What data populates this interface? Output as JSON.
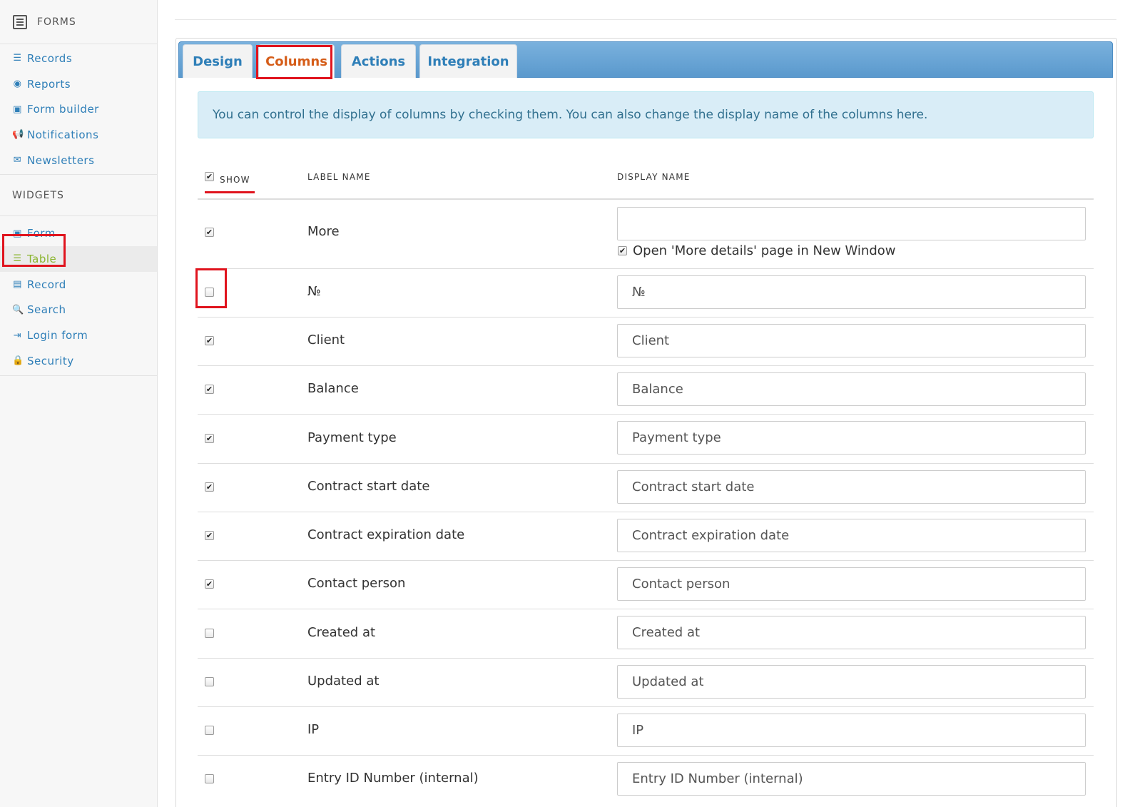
{
  "sidebar": {
    "title": "FORMS",
    "items": [
      {
        "label": "Records",
        "icon": "list-icon",
        "glyph": "☰"
      },
      {
        "label": "Reports",
        "icon": "target-icon",
        "glyph": "◉"
      },
      {
        "label": "Form builder",
        "icon": "form-icon",
        "glyph": "▣"
      },
      {
        "label": "Notifications",
        "icon": "megaphone-icon",
        "glyph": "📢"
      },
      {
        "label": "Newsletters",
        "icon": "envelope-icon",
        "glyph": "✉"
      }
    ],
    "widgets_title": "WIDGETS",
    "widgets": [
      {
        "label": "Form",
        "icon": "form-icon",
        "glyph": "▣",
        "active": false
      },
      {
        "label": "Table",
        "icon": "table-icon",
        "glyph": "☰",
        "active": true
      },
      {
        "label": "Record",
        "icon": "record-icon",
        "glyph": "▤",
        "active": false
      },
      {
        "label": "Search",
        "icon": "search-icon",
        "glyph": "🔍",
        "active": false
      },
      {
        "label": "Login form",
        "icon": "login-icon",
        "glyph": "⇥",
        "active": false
      },
      {
        "label": "Security",
        "icon": "lock-icon",
        "glyph": "🔒",
        "active": false
      }
    ]
  },
  "tabs": [
    {
      "label": "Design",
      "active": false
    },
    {
      "label": "Columns",
      "active": true
    },
    {
      "label": "Actions",
      "active": false
    },
    {
      "label": "Integration",
      "active": false
    }
  ],
  "info_text": "You can control the display of columns by checking them. You can also change the display name of the columns here.",
  "table": {
    "headers": {
      "show": "SHOW",
      "label": "LABEL NAME",
      "display": "DISPLAY NAME"
    },
    "show_all_checked": true,
    "new_window_label": "Open 'More details' page in New Window",
    "new_window_checked": true,
    "rows": [
      {
        "label": "More",
        "display": "",
        "checked": true
      },
      {
        "label": "№",
        "display": "№",
        "checked": false
      },
      {
        "label": "Client",
        "display": "Client",
        "checked": true
      },
      {
        "label": "Balance",
        "display": "Balance",
        "checked": true
      },
      {
        "label": "Payment type",
        "display": "Payment type",
        "checked": true
      },
      {
        "label": "Contract start date",
        "display": "Contract start date",
        "checked": true
      },
      {
        "label": "Contract expiration date",
        "display": "Contract expiration date",
        "checked": true
      },
      {
        "label": "Contact person",
        "display": "Contact person",
        "checked": true
      },
      {
        "label": "Created at",
        "display": "Created at",
        "checked": false
      },
      {
        "label": "Updated at",
        "display": "Updated at",
        "checked": false
      },
      {
        "label": "IP",
        "display": "IP",
        "checked": false
      },
      {
        "label": "Entry ID Number (internal)",
        "display": "Entry ID Number (internal)",
        "checked": false
      }
    ]
  },
  "colors": {
    "link": "#2f7fb8",
    "active_widget": "#8ab42e",
    "active_tab": "#d55d19",
    "highlight": "#e0141e"
  }
}
